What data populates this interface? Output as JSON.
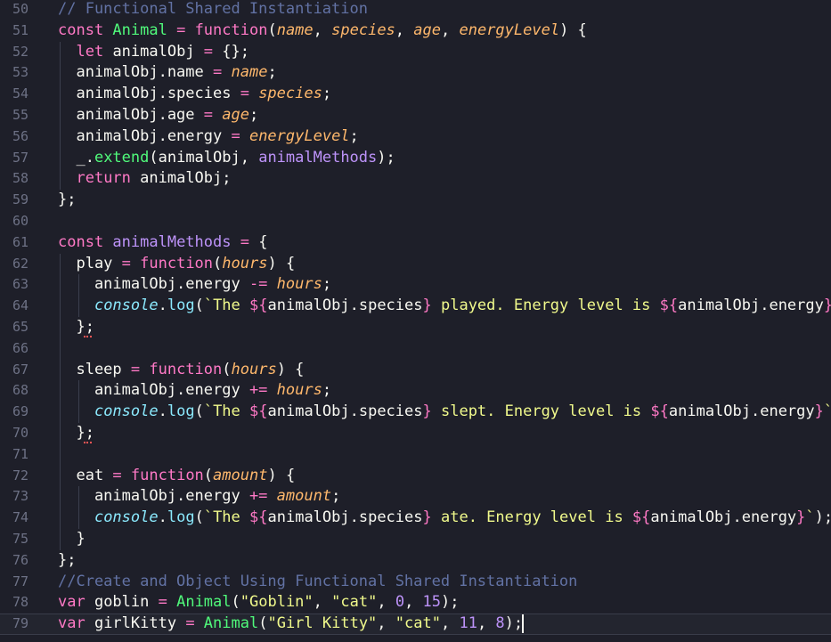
{
  "editor": {
    "theme": {
      "background": "#1e1f29",
      "comment": "#6272a4",
      "keyword": "#ff79c6",
      "function": "#50fa7b",
      "parameter": "#ffb86c",
      "string": "#f1fa8c",
      "number": "#bd93f9",
      "builtin": "#8be9fd",
      "text": "#f8f8f2",
      "line_number": "#6d7185"
    },
    "current_line": 79,
    "lines": [
      {
        "n": 50,
        "tokens": [
          [
            "comment",
            "// Functional Shared Instantiation"
          ]
        ]
      },
      {
        "n": 51,
        "tokens": [
          [
            "kw",
            "const "
          ],
          [
            "fn",
            "Animal"
          ],
          [
            "kw",
            " = "
          ],
          [
            "kw",
            "function"
          ],
          [
            "plain",
            "("
          ],
          [
            "param",
            "name"
          ],
          [
            "plain",
            ", "
          ],
          [
            "param",
            "species"
          ],
          [
            "plain",
            ", "
          ],
          [
            "param",
            "age"
          ],
          [
            "plain",
            ", "
          ],
          [
            "param",
            "energyLevel"
          ],
          [
            "plain",
            ") {"
          ]
        ]
      },
      {
        "n": 52,
        "tokens": [
          [
            "plain",
            "  "
          ],
          [
            "kw",
            "let "
          ],
          [
            "plain",
            "animalObj "
          ],
          [
            "kw",
            "= "
          ],
          [
            "plain",
            "{};"
          ]
        ]
      },
      {
        "n": 53,
        "tokens": [
          [
            "plain",
            "  animalObj.name "
          ],
          [
            "kw",
            "= "
          ],
          [
            "param",
            "name"
          ],
          [
            "plain",
            ";"
          ]
        ]
      },
      {
        "n": 54,
        "tokens": [
          [
            "plain",
            "  animalObj.species "
          ],
          [
            "kw",
            "= "
          ],
          [
            "param",
            "species"
          ],
          [
            "plain",
            ";"
          ]
        ]
      },
      {
        "n": 55,
        "tokens": [
          [
            "plain",
            "  animalObj.age "
          ],
          [
            "kw",
            "= "
          ],
          [
            "param",
            "age"
          ],
          [
            "plain",
            ";"
          ]
        ]
      },
      {
        "n": 56,
        "tokens": [
          [
            "plain",
            "  animalObj.energy "
          ],
          [
            "kw",
            "= "
          ],
          [
            "param",
            "energyLevel"
          ],
          [
            "plain",
            ";"
          ]
        ]
      },
      {
        "n": 57,
        "tokens": [
          [
            "plain",
            "  _."
          ],
          [
            "fn",
            "extend"
          ],
          [
            "plain",
            "(animalObj, "
          ],
          [
            "purple",
            "animalMethods"
          ],
          [
            "plain",
            ");"
          ]
        ]
      },
      {
        "n": 58,
        "tokens": [
          [
            "plain",
            "  "
          ],
          [
            "kw",
            "return "
          ],
          [
            "plain",
            "animalObj;"
          ]
        ]
      },
      {
        "n": 59,
        "tokens": [
          [
            "plain",
            "};"
          ]
        ]
      },
      {
        "n": 60,
        "tokens": []
      },
      {
        "n": 61,
        "tokens": [
          [
            "kw",
            "const "
          ],
          [
            "purple",
            "animalMethods"
          ],
          [
            "kw",
            " = "
          ],
          [
            "plain",
            "{"
          ]
        ]
      },
      {
        "n": 62,
        "tokens": [
          [
            "plain",
            "  play "
          ],
          [
            "kw",
            "= "
          ],
          [
            "kw",
            "function"
          ],
          [
            "plain",
            "("
          ],
          [
            "param",
            "hours"
          ],
          [
            "plain",
            ") {"
          ]
        ]
      },
      {
        "n": 63,
        "tokens": [
          [
            "plain",
            "    animalObj.energy "
          ],
          [
            "kw",
            "-= "
          ],
          [
            "param",
            "hours"
          ],
          [
            "plain",
            ";"
          ]
        ]
      },
      {
        "n": 64,
        "tokens": [
          [
            "plain",
            "    "
          ],
          [
            "console",
            "console"
          ],
          [
            "plain",
            "."
          ],
          [
            "prop",
            "log"
          ],
          [
            "plain",
            "("
          ],
          [
            "str",
            "`The "
          ],
          [
            "kw",
            "${"
          ],
          [
            "plain",
            "animalObj.species"
          ],
          [
            "kw",
            "}"
          ],
          [
            "str",
            " played. Energy level is "
          ],
          [
            "kw",
            "${"
          ],
          [
            "plain",
            "animalObj.energy"
          ],
          [
            "kw",
            "}"
          ],
          [
            "str",
            "!`"
          ],
          [
            "plain",
            ");"
          ]
        ]
      },
      {
        "n": 65,
        "tokens": [
          [
            "plain",
            "  };"
          ]
        ]
      },
      {
        "n": 66,
        "tokens": []
      },
      {
        "n": 67,
        "tokens": [
          [
            "plain",
            "  sleep "
          ],
          [
            "kw",
            "= "
          ],
          [
            "kw",
            "function"
          ],
          [
            "plain",
            "("
          ],
          [
            "param",
            "hours"
          ],
          [
            "plain",
            ") {"
          ]
        ]
      },
      {
        "n": 68,
        "tokens": [
          [
            "plain",
            "    animalObj.energy "
          ],
          [
            "kw",
            "+= "
          ],
          [
            "param",
            "hours"
          ],
          [
            "plain",
            ";"
          ]
        ]
      },
      {
        "n": 69,
        "tokens": [
          [
            "plain",
            "    "
          ],
          [
            "console",
            "console"
          ],
          [
            "plain",
            "."
          ],
          [
            "prop",
            "log"
          ],
          [
            "plain",
            "("
          ],
          [
            "str",
            "`The "
          ],
          [
            "kw",
            "${"
          ],
          [
            "plain",
            "animalObj.species"
          ],
          [
            "kw",
            "}"
          ],
          [
            "str",
            " slept. Energy level is "
          ],
          [
            "kw",
            "${"
          ],
          [
            "plain",
            "animalObj.energy"
          ],
          [
            "kw",
            "}"
          ],
          [
            "str",
            "`"
          ],
          [
            "plain",
            ")"
          ]
        ]
      },
      {
        "n": 70,
        "tokens": [
          [
            "plain",
            "  };"
          ]
        ]
      },
      {
        "n": 71,
        "tokens": []
      },
      {
        "n": 72,
        "tokens": [
          [
            "plain",
            "  eat "
          ],
          [
            "kw",
            "= "
          ],
          [
            "kw",
            "function"
          ],
          [
            "plain",
            "("
          ],
          [
            "param",
            "amount"
          ],
          [
            "plain",
            ") {"
          ]
        ]
      },
      {
        "n": 73,
        "tokens": [
          [
            "plain",
            "    animalObj.energy "
          ],
          [
            "kw",
            "+= "
          ],
          [
            "param",
            "amount"
          ],
          [
            "plain",
            ";"
          ]
        ]
      },
      {
        "n": 74,
        "tokens": [
          [
            "plain",
            "    "
          ],
          [
            "console",
            "console"
          ],
          [
            "plain",
            "."
          ],
          [
            "prop",
            "log"
          ],
          [
            "plain",
            "("
          ],
          [
            "str",
            "`The "
          ],
          [
            "kw",
            "${"
          ],
          [
            "plain",
            "animalObj.species"
          ],
          [
            "kw",
            "}"
          ],
          [
            "str",
            " ate. Energy level is "
          ],
          [
            "kw",
            "${"
          ],
          [
            "plain",
            "animalObj.energy"
          ],
          [
            "kw",
            "}"
          ],
          [
            "str",
            "`"
          ],
          [
            "plain",
            ");"
          ]
        ]
      },
      {
        "n": 75,
        "tokens": [
          [
            "plain",
            "  }"
          ]
        ]
      },
      {
        "n": 76,
        "tokens": [
          [
            "plain",
            "};"
          ]
        ]
      },
      {
        "n": 77,
        "tokens": [
          [
            "comment",
            "//Create and Object Using Functional Shared Instantiation"
          ]
        ]
      },
      {
        "n": 78,
        "tokens": [
          [
            "kw",
            "var "
          ],
          [
            "plain",
            "goblin "
          ],
          [
            "kw",
            "= "
          ],
          [
            "fn",
            "Animal"
          ],
          [
            "plain",
            "("
          ],
          [
            "str",
            "\"Goblin\""
          ],
          [
            "plain",
            ", "
          ],
          [
            "str",
            "\"cat\""
          ],
          [
            "plain",
            ", "
          ],
          [
            "num",
            "0"
          ],
          [
            "plain",
            ", "
          ],
          [
            "num",
            "15"
          ],
          [
            "plain",
            ");"
          ]
        ]
      },
      {
        "n": 79,
        "tokens": [
          [
            "kw",
            "var "
          ],
          [
            "plain",
            "girlKitty "
          ],
          [
            "kw",
            "= "
          ],
          [
            "fn",
            "Animal"
          ],
          [
            "plain",
            "("
          ],
          [
            "str",
            "\"Girl Kitty\""
          ],
          [
            "plain",
            ", "
          ],
          [
            "str",
            "\"cat\""
          ],
          [
            "plain",
            ", "
          ],
          [
            "num",
            "11"
          ],
          [
            "plain",
            ", "
          ],
          [
            "num",
            "8"
          ],
          [
            "plain",
            ");"
          ]
        ]
      }
    ]
  }
}
